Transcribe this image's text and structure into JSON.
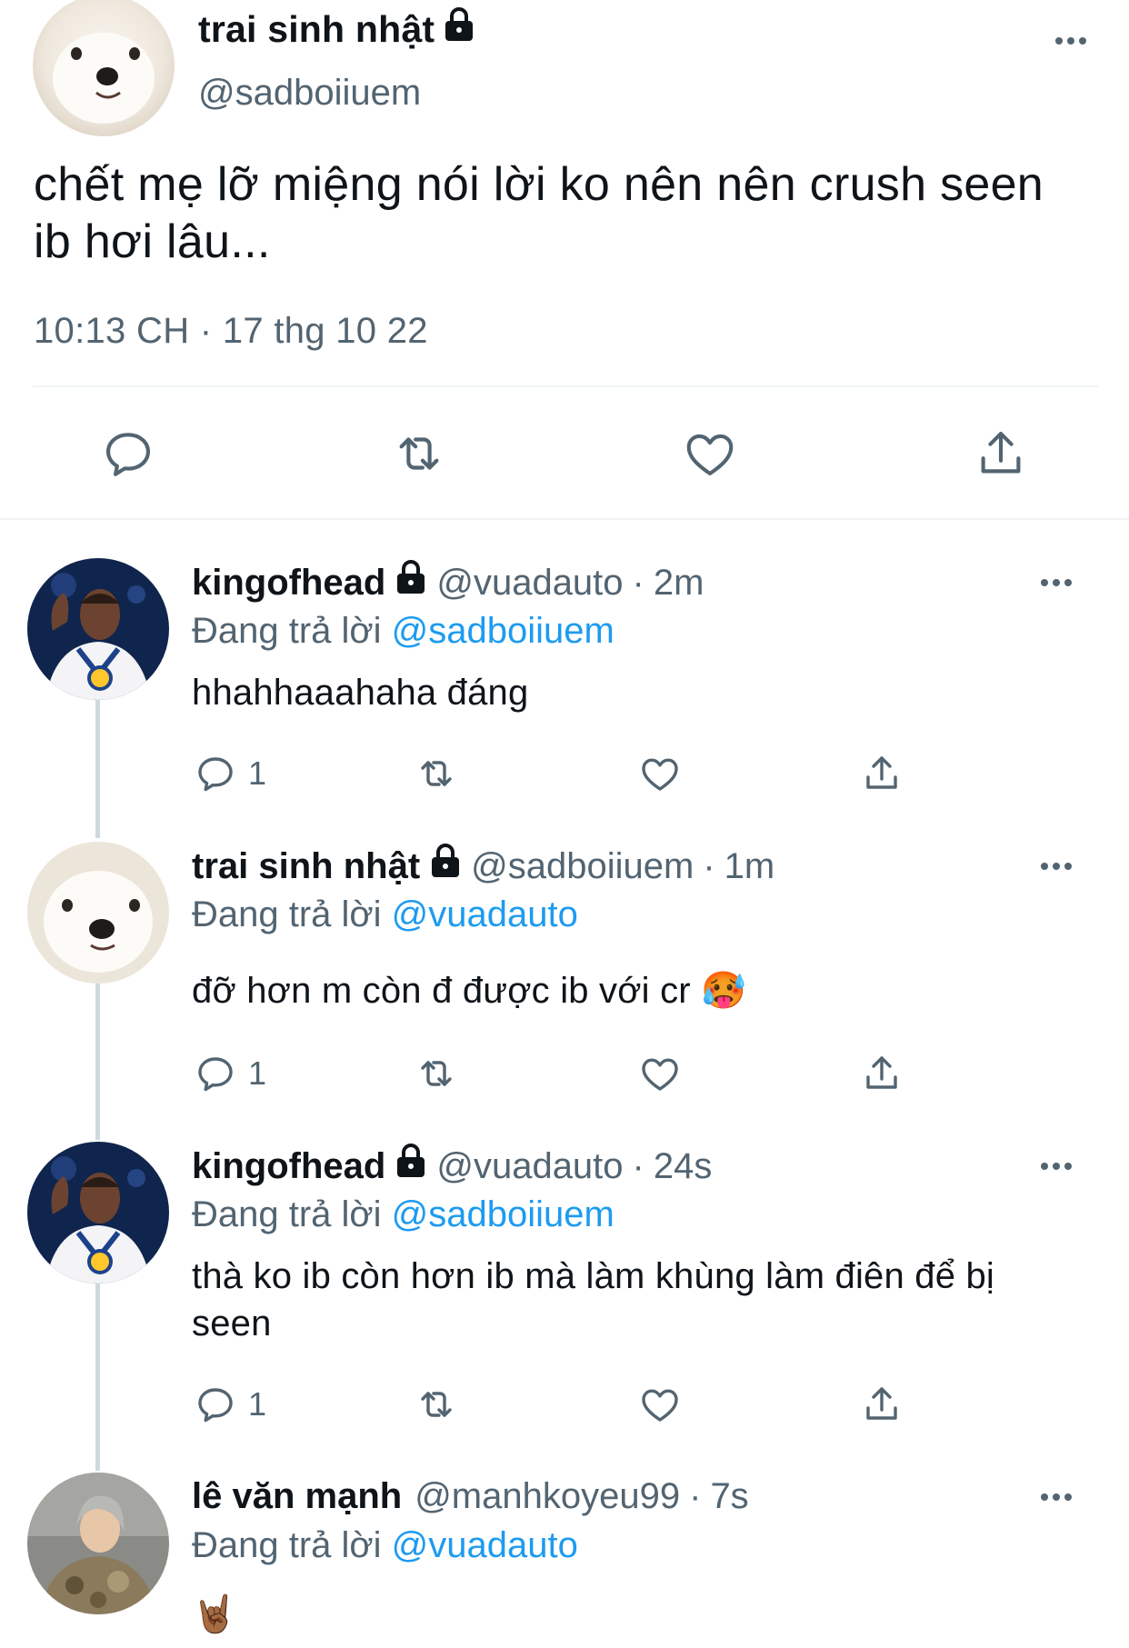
{
  "main_tweet": {
    "name": "trai sinh nhật",
    "handle": "@sadboiiuem",
    "text": "chết mẹ lỡ miệng nói lời ko nên nên crush seen ib hơi lâu...",
    "timestamp": "10:13 CH · 17 thg 10 22",
    "locked": true
  },
  "replies": [
    {
      "name": "kingofhead",
      "locked": true,
      "handle": "@vuadauto",
      "time": "2m",
      "reply_prefix": "Đang trả lời ",
      "reply_to": "@sadboiiuem",
      "text": "hhahhaaahaha đáng",
      "reply_count": "1",
      "avatar": "basketball-player-avatar"
    },
    {
      "name": "trai sinh nhật",
      "locked": true,
      "handle": "@sadboiiuem",
      "time": "1m",
      "reply_prefix": "Đang trả lời ",
      "reply_to": "@vuadauto",
      "text": "đỡ hơn m còn đ được ib với cr 🥵",
      "reply_count": "1",
      "avatar": "white-dog-avatar"
    },
    {
      "name": "kingofhead",
      "locked": true,
      "handle": "@vuadauto",
      "time": "24s",
      "reply_prefix": "Đang trả lời ",
      "reply_to": "@sadboiiuem",
      "text": "thà ko ib còn hơn ib mà làm khùng làm điên để bị seen",
      "reply_count": "1",
      "avatar": "basketball-player-avatar"
    },
    {
      "name": "lê văn mạnh",
      "locked": false,
      "handle": "@manhkoyeu99",
      "time": "7s",
      "reply_prefix": "Đang trả lời ",
      "reply_to": "@vuadauto",
      "text": "🤘🏾",
      "avatar": "person-camo-jacket-avatar"
    }
  ],
  "separator": "·",
  "colors": {
    "text": "#0f1419",
    "secondary": "#536471",
    "mention": "#1d9bf0",
    "divider": "#eff3f4",
    "thread_line": "#cfd9de"
  },
  "icons": [
    "reply-icon",
    "retweet-icon",
    "like-icon",
    "share-icon",
    "more-icon",
    "lock-icon"
  ]
}
